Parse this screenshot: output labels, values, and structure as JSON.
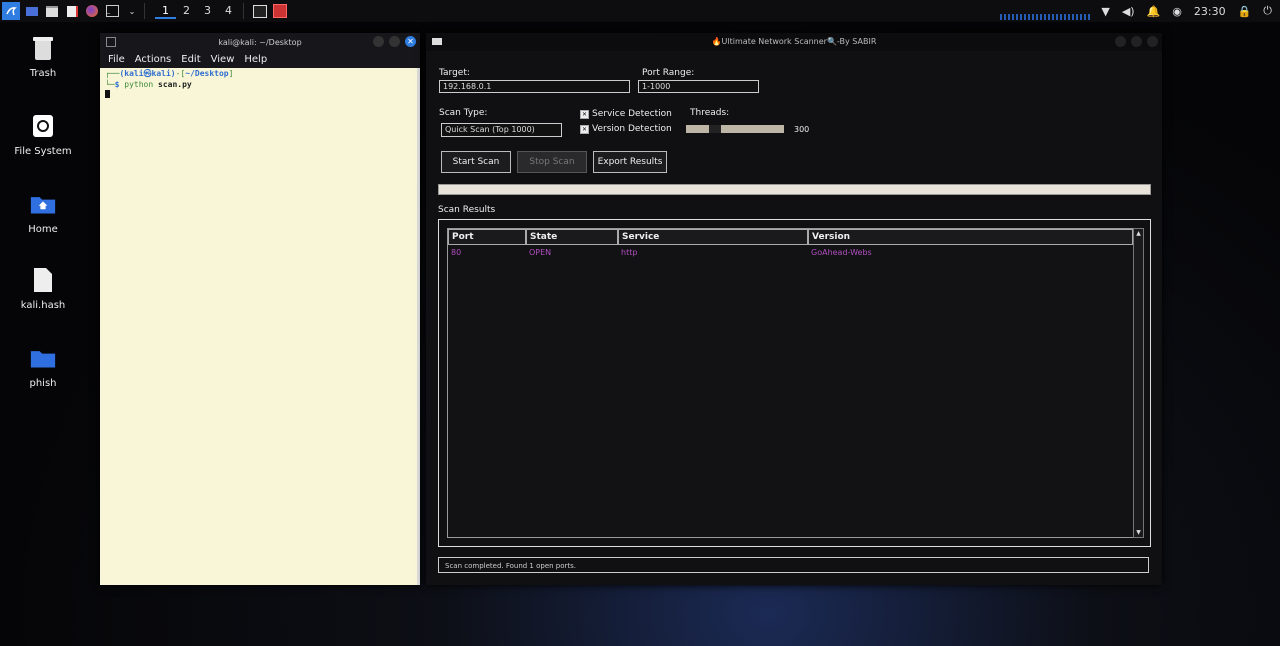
{
  "panel": {
    "workspaces": [
      "1",
      "2",
      "3",
      "4"
    ],
    "active_workspace": "1",
    "clock": "23:30"
  },
  "desktop": {
    "icons": [
      {
        "label": "Trash",
        "icon": "trash-icon"
      },
      {
        "label": "File System",
        "icon": "drive-icon"
      },
      {
        "label": "Home",
        "icon": "home-folder-icon"
      },
      {
        "label": "kali.hash",
        "icon": "file-icon"
      },
      {
        "label": "phish",
        "icon": "folder-icon"
      }
    ]
  },
  "terminal": {
    "title": "kali@kali: ~/Desktop",
    "menu": [
      "File",
      "Actions",
      "Edit",
      "View",
      "Help"
    ],
    "prompt_user": "(kali㉿kali)",
    "prompt_path": "~/Desktop",
    "command_prefix": "python",
    "command_arg": "scan.py"
  },
  "scanner": {
    "title": "🔥Ultimate Network Scanner🔍-By SABIR",
    "target_label": "Target:",
    "target_value": "192.168.0.1",
    "port_range_label": "Port Range:",
    "port_range_value": "1-1000",
    "scan_type_label": "Scan Type:",
    "scan_type_value": "Quick Scan (Top 1000)",
    "service_detection_label": "Service Detection",
    "version_detection_label": "Version Detection",
    "threads_label": "Threads:",
    "threads_value": "300",
    "start_label": "Start Scan",
    "stop_label": "Stop Scan",
    "export_label": "Export Results",
    "progress": 1.0,
    "results_label": "Scan Results",
    "columns": [
      "Port",
      "State",
      "Service",
      "Version"
    ],
    "rows": [
      {
        "port": "80",
        "state": "OPEN",
        "service": "http",
        "version": "GoAhead-Webs"
      }
    ],
    "status": "Scan completed. Found 1 open ports."
  }
}
